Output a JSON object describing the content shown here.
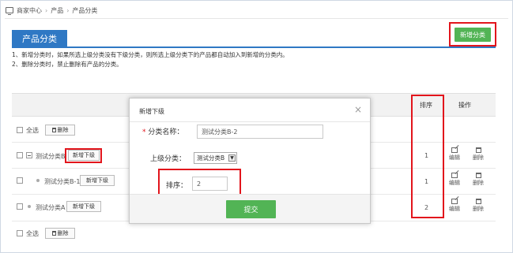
{
  "breadcrumb": [
    "商家中心",
    "产品",
    "产品分类"
  ],
  "page_title": "产品分类",
  "add_category_button": "新增分类",
  "notes": [
    "1、新增分类时，如果所选上级分类没有下级分类，则所选上级分类下的产品都自动加入到新增的分类内。",
    "2、删除分类时，禁止删除有产品的分类。"
  ],
  "table": {
    "col_sort": "排序",
    "col_op": "操作",
    "select_all": "全选",
    "delete": "删除",
    "edit": "编辑",
    "add_sub": "新增下级",
    "rows": [
      {
        "name": "测试分类B",
        "sort": "1"
      },
      {
        "name": "测试分类B-1",
        "sort": "1"
      },
      {
        "name": "测试分类A",
        "sort": "2"
      }
    ]
  },
  "modal": {
    "title": "新增下级",
    "close": "×",
    "name_label": "分类名称：",
    "name_value": "测试分类B-2",
    "parent_label": "上级分类：",
    "parent_value": "测试分类B",
    "sort_label": "排序：",
    "sort_value": "2",
    "submit": "提交"
  },
  "colors": {
    "accent_blue": "#2f78c4",
    "green": "#52b455",
    "annotation_red": "#e2151c"
  },
  "icons": [
    "monitor-icon",
    "trash-icon",
    "edit-icon",
    "minus-icon",
    "close-icon",
    "chevron-down-icon"
  ]
}
